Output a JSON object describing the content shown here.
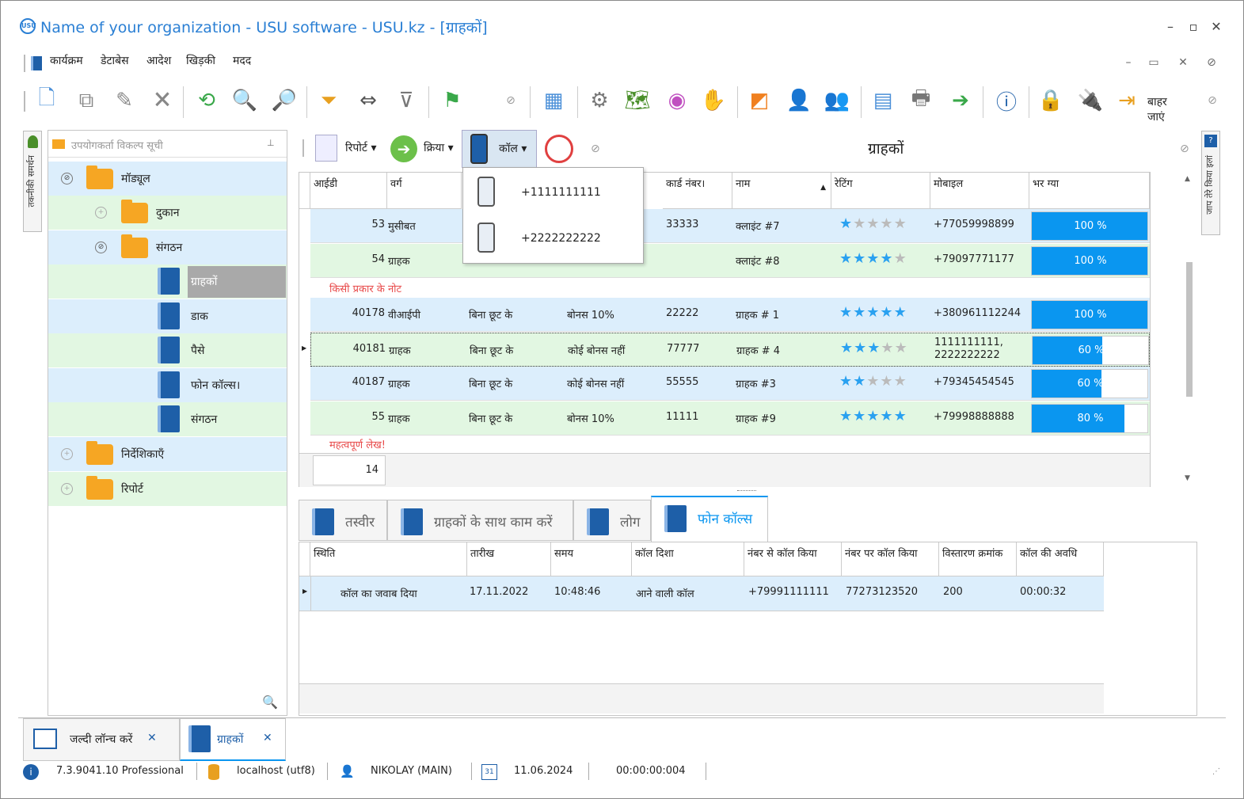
{
  "window": {
    "title": "Name of your organization - USU software - USU.kz - [ग्राहकों]",
    "logo_text": "USU",
    "min": "–",
    "max": "▫",
    "close": "✕"
  },
  "menu": [
    "कार्यक्रम",
    "डेटाबेस",
    "आदेश",
    "खिड़की",
    "मदद"
  ],
  "toolbar": {
    "exit_label": "बाहर जाएं"
  },
  "left_strip": {
    "label": "तकनीकी समर्थन"
  },
  "right_strip": {
    "label": "जाप तेरे किया इलां"
  },
  "user_options": {
    "placeholder": "उपयोगकर्ता विकल्प सूची",
    "pin": "⊥"
  },
  "tree": {
    "modules": "मॉड्यूल",
    "shop": "दुकान",
    "organization": "संगठन",
    "customers": "ग्राहकों",
    "mail": "डाक",
    "money": "पैसे",
    "phone_calls": "फोन कॉल्स।",
    "org2": "संगठन",
    "directories": "निर्देशिकाएँ",
    "reports": "रिपोर्ट"
  },
  "panel": {
    "title": "ग्राहकों",
    "report": "रिपोर्ट",
    "action": "क्रिया",
    "call": "कॉल"
  },
  "call_popup": {
    "items": [
      "+1111111111",
      "+2222222222"
    ]
  },
  "grid": {
    "columns": [
      "आईडी",
      "वर्ग",
      "",
      "",
      "कार्ड नंबर।",
      "नाम",
      "रेटिंग",
      "मोबाइल",
      "भर ग्या"
    ],
    "rows": [
      {
        "id": "53",
        "cat": "मुसीबत",
        "disc": "",
        "bonus": "",
        "card": "33333",
        "name": "क्लाइंट #7",
        "rating": 1,
        "mobile": "+77059998899",
        "fill": "100 %",
        "fill_value": 100
      },
      {
        "id": "54",
        "cat": "ग्राहक",
        "disc": "",
        "bonus": "",
        "card": "",
        "name": "क्लाइंट #8",
        "rating": 4,
        "mobile": "+79097771177",
        "fill": "100 %",
        "fill_value": 100
      },
      {
        "id": "40178",
        "cat": "वीआईपी",
        "disc": "बिना छूट के",
        "bonus": "बोनस 10%",
        "card": "22222",
        "name": "ग्राहक # 1",
        "rating": 5,
        "mobile": "+380961112244",
        "fill": "100 %",
        "fill_value": 100
      },
      {
        "id": "40181",
        "cat": "ग्राहक",
        "disc": "बिना छूट के",
        "bonus": "कोई बोनस नहीं",
        "card": "77777",
        "name": "ग्राहक # 4",
        "rating": 3,
        "mobile": "1111111111,\n2222222222",
        "fill": "60 %",
        "fill_value": 60
      },
      {
        "id": "40187",
        "cat": "ग्राहक",
        "disc": "बिना छूट के",
        "bonus": "कोई बोनस नहीं",
        "card": "55555",
        "name": "ग्राहक #3",
        "rating": 2,
        "mobile": "+79345454545",
        "fill": "60 %",
        "fill_value": 60
      },
      {
        "id": "55",
        "cat": "ग्राहक",
        "disc": "बिना छूट के",
        "bonus": "बोनस 10%",
        "card": "11111",
        "name": "ग्राहक #9",
        "rating": 5,
        "mobile": "+79998888888",
        "fill": "80 %",
        "fill_value": 80
      }
    ],
    "note1": "किसी प्रकार के नोट",
    "note2": "महत्वपूर्ण लेख!",
    "count": "14"
  },
  "tabs": [
    "तस्वीर",
    "ग्राहकों के साथ काम करें",
    "लोग",
    "फोन कॉल्स"
  ],
  "calls": {
    "columns": [
      "स्थिति",
      "तारीख",
      "समय",
      "कॉल दिशा",
      "नंबर से कॉल किया",
      "नंबर पर कॉल किया",
      "विस्तारण क्रमांक",
      "कॉल की अवधि"
    ],
    "row": [
      "कॉल का जवाब दिया",
      "17.11.2022",
      "10:48:46",
      "आने वाली कॉल",
      "+79991111111",
      "77273123520",
      "200",
      "00:00:32"
    ]
  },
  "bottom_tabs": [
    "जल्दी लॉन्च करें",
    "ग्राहकों"
  ],
  "status": {
    "version": "7.3.9041.10 Professional",
    "db": "localhost (utf8)",
    "user": "NIKOLAY (MAIN)",
    "date": "11.06.2024",
    "timer": "00:00:00:004",
    "cal": "31"
  },
  "colors": {
    "accent": "#0a96f0",
    "row_blue": "#dceefc",
    "row_green": "#e2f7e2",
    "note": "#e84b4b"
  }
}
